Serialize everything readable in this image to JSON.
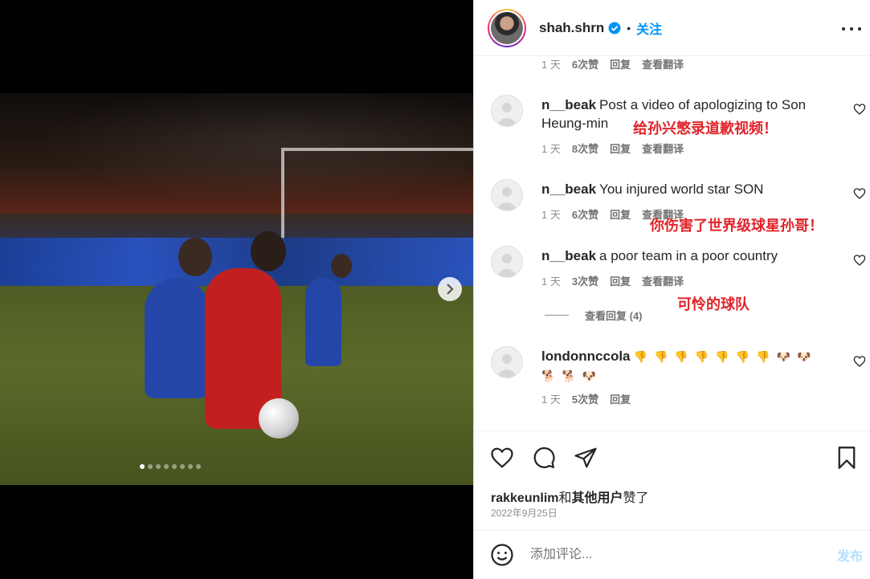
{
  "post": {
    "username": "shah.shrn",
    "follow_label": "关注",
    "separator": "•",
    "verified": true,
    "carousel": {
      "total": 8,
      "current": 1
    }
  },
  "colors": {
    "accent": "#0095f6",
    "annotation": "#e0242a",
    "text": "#262626",
    "muted": "#737373"
  },
  "top_meta": {
    "time": "1 天",
    "likes": "6次赞",
    "reply": "回复",
    "translate": "查看翻译"
  },
  "comments": [
    {
      "user": "n__beak",
      "text": "Post a video of apologizing to Son Heung-min",
      "time": "1 天",
      "likes": "8次赞",
      "reply": "回复",
      "translate": "查看翻译",
      "annotation": "给孙兴慜录道歉视频！"
    },
    {
      "user": "n__beak",
      "text": "You injured world star SON",
      "time": "1 天",
      "likes": "6次赞",
      "reply": "回复",
      "translate": "查看翻译",
      "annotation": "你伤害了世界级球星孙哥！"
    },
    {
      "user": "n__beak",
      "text": "a poor team in a poor country",
      "time": "1 天",
      "likes": "3次赞",
      "reply": "回复",
      "translate": "查看翻译",
      "annotation": "可怜的球队",
      "view_replies": "查看回复 (4)"
    },
    {
      "user": "londonnccola",
      "emojis": [
        "👎",
        "👎",
        "👎",
        "👎",
        "👎",
        "👎",
        "👎",
        "🐶",
        "🐶",
        "🐕",
        "🐕",
        "🐶"
      ],
      "time": "1 天",
      "likes": "5次赞",
      "reply": "回复"
    }
  ],
  "likes_summary": {
    "first_user": "rakkeunlim",
    "connector": "和",
    "others": "其他用户",
    "suffix": "赞了"
  },
  "date": "2022年9月25日",
  "composer": {
    "placeholder": "添加评论...",
    "post_label": "发布"
  }
}
